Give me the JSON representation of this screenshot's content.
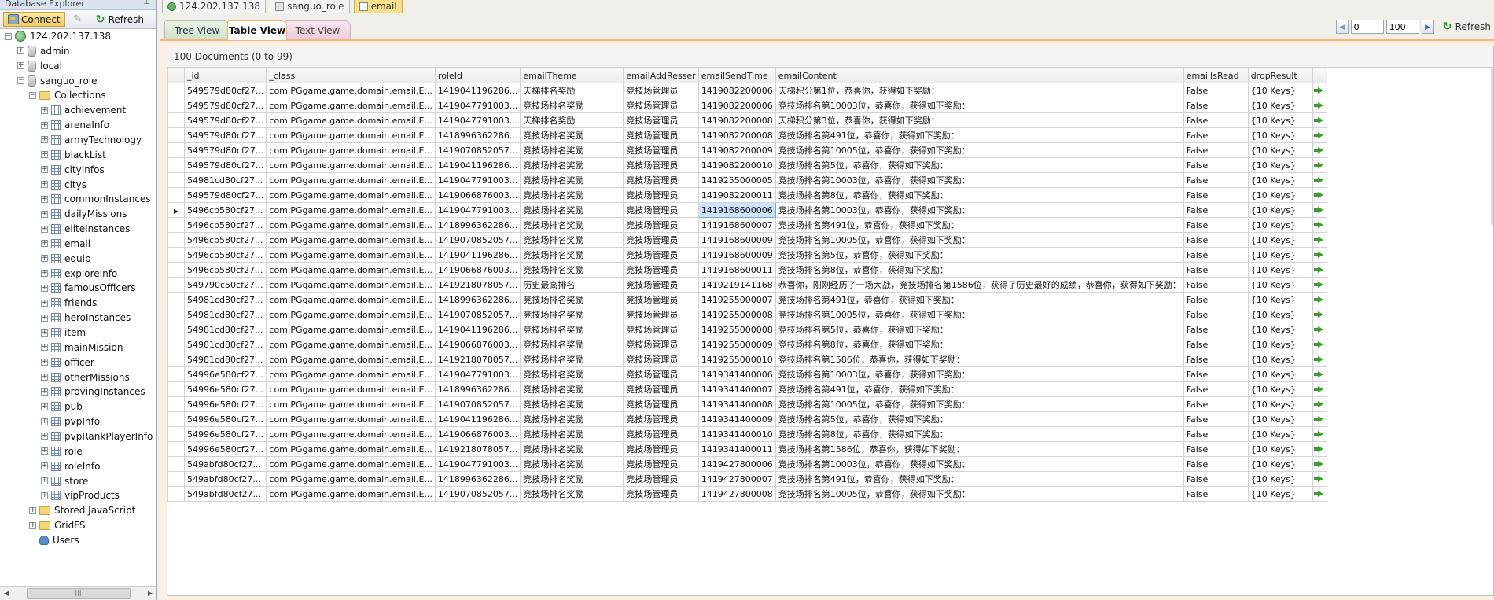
{
  "explorer": {
    "title": "Database Explorer",
    "pin_icon": "pin-icon",
    "toolbar": {
      "connect_label": "Connect",
      "refresh_label": "Refresh"
    },
    "tree": {
      "server": "124.202.137.138",
      "databases": [
        "admin",
        "local",
        "sanguo_role"
      ],
      "collections_folder": "Collections",
      "collections": [
        "achievement",
        "arenaInfo",
        "armyTechnology",
        "blackList",
        "cityInfos",
        "citys",
        "commonInstances",
        "dailyMissions",
        "eliteInstances",
        "email",
        "equip",
        "exploreInfo",
        "famousOfficers",
        "friends",
        "heroInstances",
        "item",
        "mainMission",
        "officer",
        "otherMissions",
        "provingInstances",
        "pub",
        "pvpInfo",
        "pvpRankPlayerInfo",
        "role",
        "roleInfo",
        "store",
        "vipProducts"
      ],
      "stored_js": "Stored JavaScript",
      "gridfs": "GridFS",
      "users": "Users"
    }
  },
  "doc_tabs": [
    "124.202.137.138",
    "sanguo_role",
    "email"
  ],
  "view_tabs": {
    "tree": "Tree View",
    "table": "Table View",
    "text": "Text View"
  },
  "pager": {
    "skip": "0",
    "limit": "100",
    "refresh_label": "Refresh"
  },
  "grid": {
    "status": "100 Documents (0 to 99)",
    "columns": [
      "_id",
      "_class",
      "roleId",
      "emailTheme",
      "emailAddResser",
      "emailSendTime",
      "emailContent",
      "emailIsRead",
      "dropResult"
    ],
    "rows": [
      [
        "549579d80cf27...",
        "com.PGgame.game.domain.email.E...",
        "1419041196286...",
        "天梯排名奖励",
        "竞技场管理员",
        "1419082200006",
        "天梯积分第1位，恭喜你，获得如下奖励：",
        "False",
        "{10 Keys}"
      ],
      [
        "549579d80cf27...",
        "com.PGgame.game.domain.email.E...",
        "1419047791003...",
        "竞技场排名奖励",
        "竞技场管理员",
        "1419082200006",
        "竞技场排名第10003位，恭喜你，获得如下奖励：",
        "False",
        "{10 Keys}"
      ],
      [
        "549579d80cf27...",
        "com.PGgame.game.domain.email.E...",
        "1419047791003...",
        "天梯排名奖励",
        "竞技场管理员",
        "1419082200008",
        "天梯积分第3位，恭喜你，获得如下奖励：",
        "False",
        "{10 Keys}"
      ],
      [
        "549579d80cf27...",
        "com.PGgame.game.domain.email.E...",
        "1418996362286...",
        "竞技场排名奖励",
        "竞技场管理员",
        "1419082200008",
        "竞技场排名第491位，恭喜你，获得如下奖励：",
        "False",
        "{10 Keys}"
      ],
      [
        "549579d80cf27...",
        "com.PGgame.game.domain.email.E...",
        "1419070852057...",
        "竞技场排名奖励",
        "竞技场管理员",
        "1419082200009",
        "竞技场排名第10005位，恭喜你，获得如下奖励：",
        "False",
        "{10 Keys}"
      ],
      [
        "549579d80cf27...",
        "com.PGgame.game.domain.email.E...",
        "1419041196286...",
        "竞技场排名奖励",
        "竞技场管理员",
        "1419082200010",
        "竞技场排名第5位，恭喜你，获得如下奖励：",
        "False",
        "{10 Keys}"
      ],
      [
        "54981cd80cf27...",
        "com.PGgame.game.domain.email.E...",
        "1419047791003...",
        "竞技场排名奖励",
        "竞技场管理员",
        "1419255000005",
        "竞技场排名第10003位，恭喜你，获得如下奖励：",
        "False",
        "{10 Keys}"
      ],
      [
        "549579d80cf27...",
        "com.PGgame.game.domain.email.E...",
        "1419066876003...",
        "竞技场排名奖励",
        "竞技场管理员",
        "1419082200011",
        "竞技场排名第8位，恭喜你，获得如下奖励：",
        "False",
        "{10 Keys}"
      ],
      [
        "5496cb580cf27...",
        "com.PGgame.game.domain.email.E...",
        "1419047791003...",
        "竞技场排名奖励",
        "竞技场管理员",
        "1419168600006",
        "竞技场排名第10003位，恭喜你，获得如下奖励：",
        "False",
        "{10 Keys}"
      ],
      [
        "5496cb580cf27...",
        "com.PGgame.game.domain.email.E...",
        "1418996362286...",
        "竞技场排名奖励",
        "竞技场管理员",
        "1419168600007",
        "竞技场排名第491位，恭喜你，获得如下奖励：",
        "False",
        "{10 Keys}"
      ],
      [
        "5496cb580cf27...",
        "com.PGgame.game.domain.email.E...",
        "1419070852057...",
        "竞技场排名奖励",
        "竞技场管理员",
        "1419168600009",
        "竞技场排名第10005位，恭喜你，获得如下奖励：",
        "False",
        "{10 Keys}"
      ],
      [
        "5496cb580cf27...",
        "com.PGgame.game.domain.email.E...",
        "1419041196286...",
        "竞技场排名奖励",
        "竞技场管理员",
        "1419168600009",
        "竞技场排名第5位，恭喜你，获得如下奖励：",
        "False",
        "{10 Keys}"
      ],
      [
        "5496cb580cf27...",
        "com.PGgame.game.domain.email.E...",
        "1419066876003...",
        "竞技场排名奖励",
        "竞技场管理员",
        "1419168600011",
        "竞技场排名第8位，恭喜你，获得如下奖励：",
        "False",
        "{10 Keys}"
      ],
      [
        "549790c50cf27...",
        "com.PGgame.game.domain.email.E...",
        "1419218078057...",
        "历史最高排名",
        "竞技场管理员",
        "1419219141168",
        "恭喜你，刚刚经历了一场大战，竞技场排名第1586位，获得了历史最好的成绩，恭喜你，获得如下奖励：",
        "False",
        "{10 Keys}"
      ],
      [
        "54981cd80cf27...",
        "com.PGgame.game.domain.email.E...",
        "1418996362286...",
        "竞技场排名奖励",
        "竞技场管理员",
        "1419255000007",
        "竞技场排名第491位，恭喜你，获得如下奖励：",
        "False",
        "{10 Keys}"
      ],
      [
        "54981cd80cf27...",
        "com.PGgame.game.domain.email.E...",
        "1419070852057...",
        "竞技场排名奖励",
        "竞技场管理员",
        "1419255000008",
        "竞技场排名第10005位，恭喜你，获得如下奖励：",
        "False",
        "{10 Keys}"
      ],
      [
        "54981cd80cf27...",
        "com.PGgame.game.domain.email.E...",
        "1419041196286...",
        "竞技场排名奖励",
        "竞技场管理员",
        "1419255000008",
        "竞技场排名第5位，恭喜你，获得如下奖励：",
        "False",
        "{10 Keys}"
      ],
      [
        "54981cd80cf27...",
        "com.PGgame.game.domain.email.E...",
        "1419066876003...",
        "竞技场排名奖励",
        "竞技场管理员",
        "1419255000009",
        "竞技场排名第8位，恭喜你，获得如下奖励：",
        "False",
        "{10 Keys}"
      ],
      [
        "54981cd80cf27...",
        "com.PGgame.game.domain.email.E...",
        "1419218078057...",
        "竞技场排名奖励",
        "竞技场管理员",
        "1419255000010",
        "竞技场排名第1586位，恭喜你，获得如下奖励：",
        "False",
        "{10 Keys}"
      ],
      [
        "54996e580cf27...",
        "com.PGgame.game.domain.email.E...",
        "1419047791003...",
        "竞技场排名奖励",
        "竞技场管理员",
        "1419341400006",
        "竞技场排名第10003位，恭喜你，获得如下奖励：",
        "False",
        "{10 Keys}"
      ],
      [
        "54996e580cf27...",
        "com.PGgame.game.domain.email.E...",
        "1418996362286...",
        "竞技场排名奖励",
        "竞技场管理员",
        "1419341400007",
        "竞技场排名第491位，恭喜你，获得如下奖励：",
        "False",
        "{10 Keys}"
      ],
      [
        "54996e580cf27...",
        "com.PGgame.game.domain.email.E...",
        "1419070852057...",
        "竞技场排名奖励",
        "竞技场管理员",
        "1419341400008",
        "竞技场排名第10005位，恭喜你，获得如下奖励：",
        "False",
        "{10 Keys}"
      ],
      [
        "54996e580cf27...",
        "com.PGgame.game.domain.email.E...",
        "1419041196286...",
        "竞技场排名奖励",
        "竞技场管理员",
        "1419341400009",
        "竞技场排名第5位，恭喜你，获得如下奖励：",
        "False",
        "{10 Keys}"
      ],
      [
        "54996e580cf27...",
        "com.PGgame.game.domain.email.E...",
        "1419066876003...",
        "竞技场排名奖励",
        "竞技场管理员",
        "1419341400010",
        "竞技场排名第8位，恭喜你，获得如下奖励：",
        "False",
        "{10 Keys}"
      ],
      [
        "54996e580cf27...",
        "com.PGgame.game.domain.email.E...",
        "1419218078057...",
        "竞技场排名奖励",
        "竞技场管理员",
        "1419341400011",
        "竞技场排名第1586位，恭喜你，获得如下奖励：",
        "False",
        "{10 Keys}"
      ],
      [
        "549abfd80cf27...",
        "com.PGgame.game.domain.email.E...",
        "1419047791003...",
        "竞技场排名奖励",
        "竞技场管理员",
        "1419427800006",
        "竞技场排名第10003位，恭喜你，获得如下奖励：",
        "False",
        "{10 Keys}"
      ],
      [
        "549abfd80cf27...",
        "com.PGgame.game.domain.email.E...",
        "1418996362286...",
        "竞技场排名奖励",
        "竞技场管理员",
        "1419427800007",
        "竞技场排名第491位，恭喜你，获得如下奖励：",
        "False",
        "{10 Keys}"
      ],
      [
        "549abfd80cf27...",
        "com.PGgame.game.domain.email.E...",
        "1419070852057...",
        "竞技场排名奖励",
        "竞技场管理员",
        "1419427800008",
        "竞技场排名第10005位，恭喜你，获得如下奖励：",
        "False",
        "{10 Keys}"
      ]
    ],
    "current_row": 8,
    "current_col": 5
  }
}
